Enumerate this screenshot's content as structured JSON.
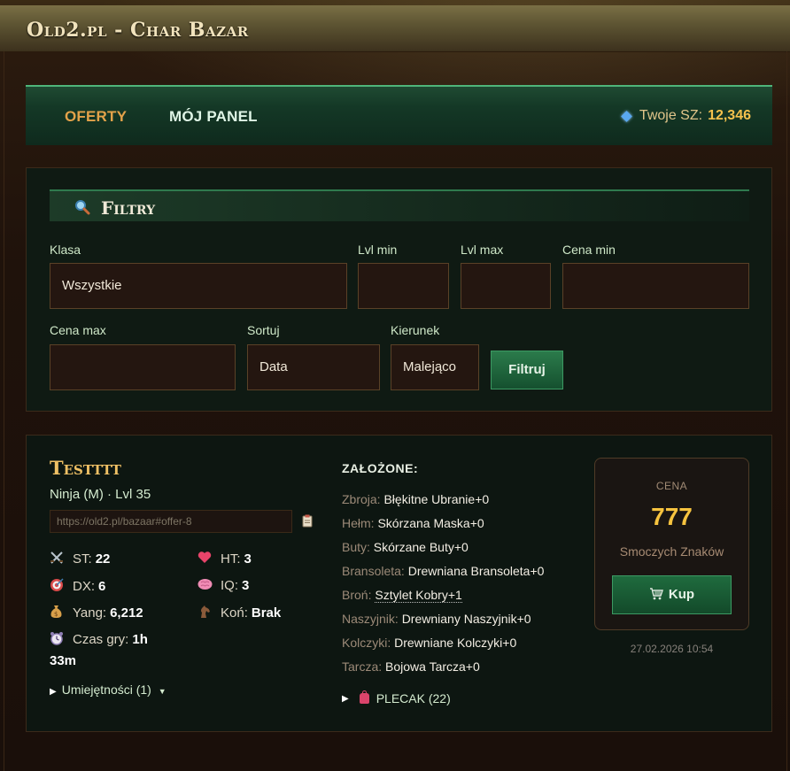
{
  "app": {
    "title": "Old2.pl - Char Bazar"
  },
  "nav": {
    "tabs": [
      {
        "label": "OFERTY",
        "active": true
      },
      {
        "label": "MÓJ PANEL",
        "active": false
      }
    ],
    "balance_label": "Twoje SZ:",
    "balance_value": "12,346",
    "balance_icon": "diamond-icon"
  },
  "filters": {
    "title": "Filtry",
    "fields": {
      "klasa": {
        "label": "Klasa",
        "value": "Wszystkie"
      },
      "lvl_min": {
        "label": "Lvl min",
        "value": ""
      },
      "lvl_max": {
        "label": "Lvl max",
        "value": ""
      },
      "cena_min": {
        "label": "Cena min",
        "value": ""
      },
      "cena_max": {
        "label": "Cena max",
        "value": ""
      },
      "sortuj": {
        "label": "Sortuj",
        "value": "Data"
      },
      "kierunek": {
        "label": "Kierunek",
        "value": "Malejąco"
      }
    },
    "submit_label": "Filtruj"
  },
  "offer": {
    "name": "Testttt",
    "subtitle": "Ninja (M) · Lvl 35",
    "link": "https://old2.pl/bazaar#offer-8",
    "stats": {
      "st": {
        "label": "ST:",
        "value": "22",
        "icon": "crossed-swords-icon"
      },
      "ht": {
        "label": "HT:",
        "value": "3",
        "icon": "heart-icon"
      },
      "dx": {
        "label": "DX:",
        "value": "6",
        "icon": "target-icon"
      },
      "iq": {
        "label": "IQ:",
        "value": "3",
        "icon": "brain-icon"
      },
      "yang": {
        "label": "Yang:",
        "value": "6,212",
        "icon": "money-bag-icon"
      },
      "kon": {
        "label": "Koń:",
        "value": "Brak",
        "icon": "horse-icon"
      },
      "czas": {
        "label": "Czas gry:",
        "value_a": "1h",
        "value_b": "33m",
        "icon": "alarm-clock-icon"
      }
    },
    "skills_label": "Umiejętności (1)",
    "equipped_title": "ZAŁOŻONE:",
    "equipment": [
      {
        "slot": "Zbroja:",
        "item": "Błękitne Ubranie+0"
      },
      {
        "slot": "Hełm:",
        "item": "Skórzana Maska+0"
      },
      {
        "slot": "Buty:",
        "item": "Skórzane Buty+0"
      },
      {
        "slot": "Bransoleta:",
        "item": "Drewniana Bransoleta+0"
      },
      {
        "slot": "Broń:",
        "item": "Sztylet Kobry+1"
      },
      {
        "slot": "Naszyjnik:",
        "item": "Drewniany Naszyjnik+0"
      },
      {
        "slot": "Kolczyki:",
        "item": "Drewniane Kolczyki+0"
      },
      {
        "slot": "Tarcza:",
        "item": "Bojowa Tarcza+0"
      }
    ],
    "backpack_label": "PLECAK (22)",
    "price": {
      "label": "CENA",
      "value": "777",
      "currency": "Smoczych Znaków",
      "buy_label": "Kup"
    },
    "date": "27.02.2026 10:54"
  },
  "colors": {
    "accent_green": "#2b7b4b",
    "gold": "#f6c33f",
    "orange_tab": "#e3a24a"
  }
}
